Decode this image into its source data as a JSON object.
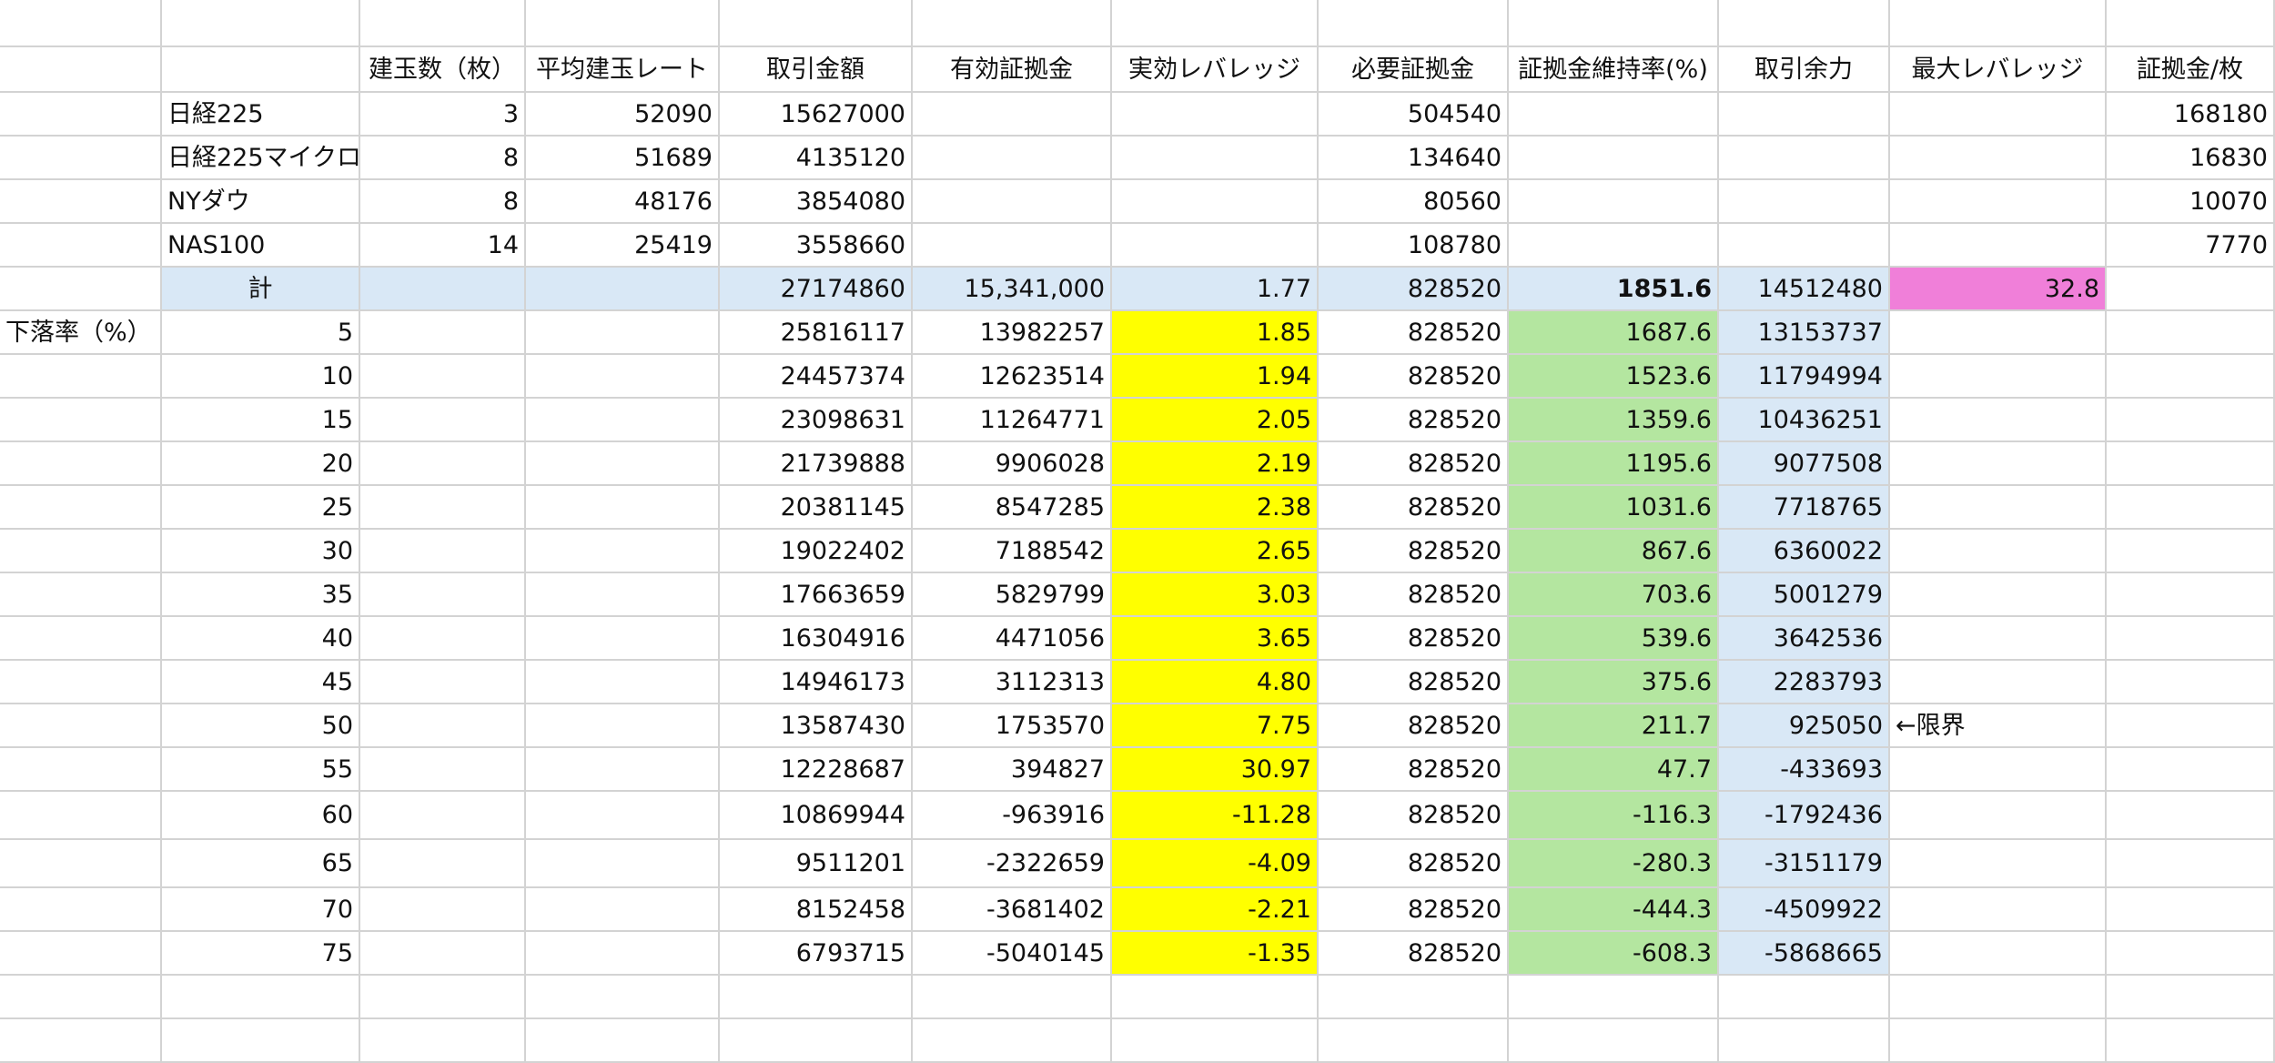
{
  "header": [
    "",
    "",
    "建玉数（枚）",
    "平均建玉レート",
    "取引金額",
    "有効証拠金",
    "実効レバレッジ",
    "必要証拠金",
    "証拠金維持率(%)",
    "取引余力",
    "最大レバレッジ",
    "証拠金/枚"
  ],
  "instruments": [
    {
      "name": "日経225",
      "qty": "3",
      "avg_rate": "52090",
      "amount": "15627000",
      "required_margin": "504540",
      "margin_per_lot": "168180"
    },
    {
      "name": "日経225マイクロ",
      "qty": "8",
      "avg_rate": "51689",
      "amount": "4135120",
      "required_margin": "134640",
      "margin_per_lot": "16830"
    },
    {
      "name": "NYダウ",
      "qty": "8",
      "avg_rate": "48176",
      "amount": "3854080",
      "required_margin": "80560",
      "margin_per_lot": "10070"
    },
    {
      "name": "NAS100",
      "qty": "14",
      "avg_rate": "25419",
      "amount": "3558660",
      "required_margin": "108780",
      "margin_per_lot": "7770"
    }
  ],
  "total": {
    "label": "計",
    "amount": "27174860",
    "equity": "15,341,000",
    "leverage": "1.77",
    "required_margin": "828520",
    "maintenance_rate": "1851.6",
    "buying_power": "14512480",
    "max_leverage": "32.8"
  },
  "drop_label": "下落率（%）",
  "limit_note": "←限界",
  "limit_row_index": 9,
  "drops": [
    {
      "pct": "5",
      "amount": "25816117",
      "equity": "13982257",
      "leverage": "1.85",
      "required_margin": "828520",
      "maintenance_rate": "1687.6",
      "buying_power": "13153737"
    },
    {
      "pct": "10",
      "amount": "24457374",
      "equity": "12623514",
      "leverage": "1.94",
      "required_margin": "828520",
      "maintenance_rate": "1523.6",
      "buying_power": "11794994"
    },
    {
      "pct": "15",
      "amount": "23098631",
      "equity": "11264771",
      "leverage": "2.05",
      "required_margin": "828520",
      "maintenance_rate": "1359.6",
      "buying_power": "10436251"
    },
    {
      "pct": "20",
      "amount": "21739888",
      "equity": "9906028",
      "leverage": "2.19",
      "required_margin": "828520",
      "maintenance_rate": "1195.6",
      "buying_power": "9077508"
    },
    {
      "pct": "25",
      "amount": "20381145",
      "equity": "8547285",
      "leverage": "2.38",
      "required_margin": "828520",
      "maintenance_rate": "1031.6",
      "buying_power": "7718765"
    },
    {
      "pct": "30",
      "amount": "19022402",
      "equity": "7188542",
      "leverage": "2.65",
      "required_margin": "828520",
      "maintenance_rate": "867.6",
      "buying_power": "6360022"
    },
    {
      "pct": "35",
      "amount": "17663659",
      "equity": "5829799",
      "leverage": "3.03",
      "required_margin": "828520",
      "maintenance_rate": "703.6",
      "buying_power": "5001279"
    },
    {
      "pct": "40",
      "amount": "16304916",
      "equity": "4471056",
      "leverage": "3.65",
      "required_margin": "828520",
      "maintenance_rate": "539.6",
      "buying_power": "3642536"
    },
    {
      "pct": "45",
      "amount": "14946173",
      "equity": "3112313",
      "leverage": "4.80",
      "required_margin": "828520",
      "maintenance_rate": "375.6",
      "buying_power": "2283793"
    },
    {
      "pct": "50",
      "amount": "13587430",
      "equity": "1753570",
      "leverage": "7.75",
      "required_margin": "828520",
      "maintenance_rate": "211.7",
      "buying_power": "925050"
    },
    {
      "pct": "55",
      "amount": "12228687",
      "equity": "394827",
      "leverage": "30.97",
      "required_margin": "828520",
      "maintenance_rate": "47.7",
      "buying_power": "-433693"
    },
    {
      "pct": "60",
      "amount": "10869944",
      "equity": "-963916",
      "leverage": "-11.28",
      "required_margin": "828520",
      "maintenance_rate": "-116.3",
      "buying_power": "-1792436"
    },
    {
      "pct": "65",
      "amount": "9511201",
      "equity": "-2322659",
      "leverage": "-4.09",
      "required_margin": "828520",
      "maintenance_rate": "-280.3",
      "buying_power": "-3151179"
    },
    {
      "pct": "70",
      "amount": "8152458",
      "equity": "-3681402",
      "leverage": "-2.21",
      "required_margin": "828520",
      "maintenance_rate": "-444.3",
      "buying_power": "-4509922"
    },
    {
      "pct": "75",
      "amount": "6793715",
      "equity": "-5040145",
      "leverage": "-1.35",
      "required_margin": "828520",
      "maintenance_rate": "-608.3",
      "buying_power": "-5868665"
    }
  ],
  "colors": {
    "grid_line": "#d3d3d3",
    "total_row_bg": "#d9e8f6",
    "leverage_bg": "#ffff00",
    "maintenance_bg": "#b4e6a0",
    "buying_power_bg": "#d9e8f6",
    "max_leverage_bg": "#f07fd9"
  }
}
